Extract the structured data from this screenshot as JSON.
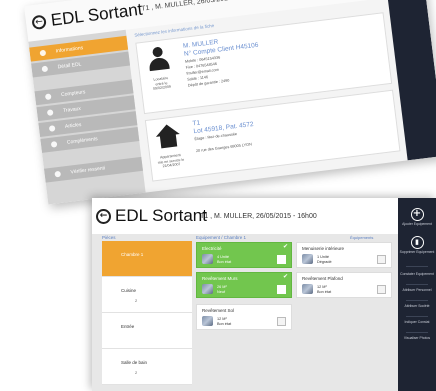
{
  "back_screen": {
    "title": "EDL Sortant",
    "subtitle": "T1 , M. MULLER, 26/05/2015 - 16h00",
    "main_header": "Sélectionnez les informations de la fiche",
    "sidebar": [
      {
        "label": "Informations",
        "active": true
      },
      {
        "label": "Détail EDL",
        "active": false
      },
      {
        "label": "Compteurs",
        "active": false
      },
      {
        "label": "Travaux",
        "active": false
      },
      {
        "label": "Articles",
        "active": false
      },
      {
        "label": "Compléments",
        "active": false
      },
      {
        "label": "Vérifier ressenti",
        "active": false
      }
    ],
    "locataire": {
      "caption_lines": [
        "Locataire",
        "entré le",
        "09/02/2009"
      ],
      "name": "M. MULLER",
      "contract": "N° Compte Client H45106",
      "lines": [
        "Mobile : 0645154336",
        "Fixe : 0476548546",
        "fmuller@email.com",
        "Solde : 1146",
        "Dépôt de garantie : 2490"
      ]
    },
    "logement": {
      "caption_lines": [
        "Appartement",
        "mis en service le",
        "21/04/2007"
      ],
      "type": "T1",
      "ref": "Lot 45918, Pat. 4572",
      "lines": [
        "Étage : Rez-de-chaussée",
        "20 rue des Granges 69005 LYON"
      ]
    }
  },
  "front_screen": {
    "title": "EDL Sortant",
    "subtitle": "T1 , M. MULLER, 26/05/2015 - 16h00",
    "back_icon": "arrow-left-icon",
    "labels": {
      "pieces": "Pièces",
      "equipements": "Equipement / Chambre 1",
      "link": "Équipements"
    },
    "rooms": [
      {
        "name": "Chambre 1",
        "count": "",
        "active": true
      },
      {
        "name": "Cuisine",
        "count": "2",
        "active": false
      },
      {
        "name": "Entrée",
        "count": "",
        "active": false
      },
      {
        "name": "Salle de bain",
        "count": "2",
        "active": false
      }
    ],
    "equipment": [
      {
        "name": "Electricité",
        "detail1": "4 Unité",
        "detail2": "Bon état",
        "done": true
      },
      {
        "name": "Menuiserie intérieure",
        "detail1": "1 Unité",
        "detail2": "Dégradé",
        "done": false
      },
      {
        "name": "Revêtement Murs",
        "detail1": "26 M²",
        "detail2": "Neuf",
        "done": true
      },
      {
        "name": "Revêtement Plafond",
        "detail1": "12 M²",
        "detail2": "Bon état",
        "done": false
      },
      {
        "name": "Revêtement Sol",
        "detail1": "12 M²",
        "detail2": "Bon état",
        "done": false
      }
    ],
    "strip": {
      "add_label": "Ajouter Equipement",
      "delete_label": "Supprimer Equipement",
      "items": [
        "Constater Equipement",
        "Attribuer Personnel",
        "Attribuer Société",
        "Indiquer Constat",
        "Visualiser Photos"
      ]
    }
  },
  "colors": {
    "accent_orange": "#f0a431",
    "done_green": "#72c64e",
    "strip_navy": "#1e2433",
    "label_blue": "#5a7fc2"
  }
}
